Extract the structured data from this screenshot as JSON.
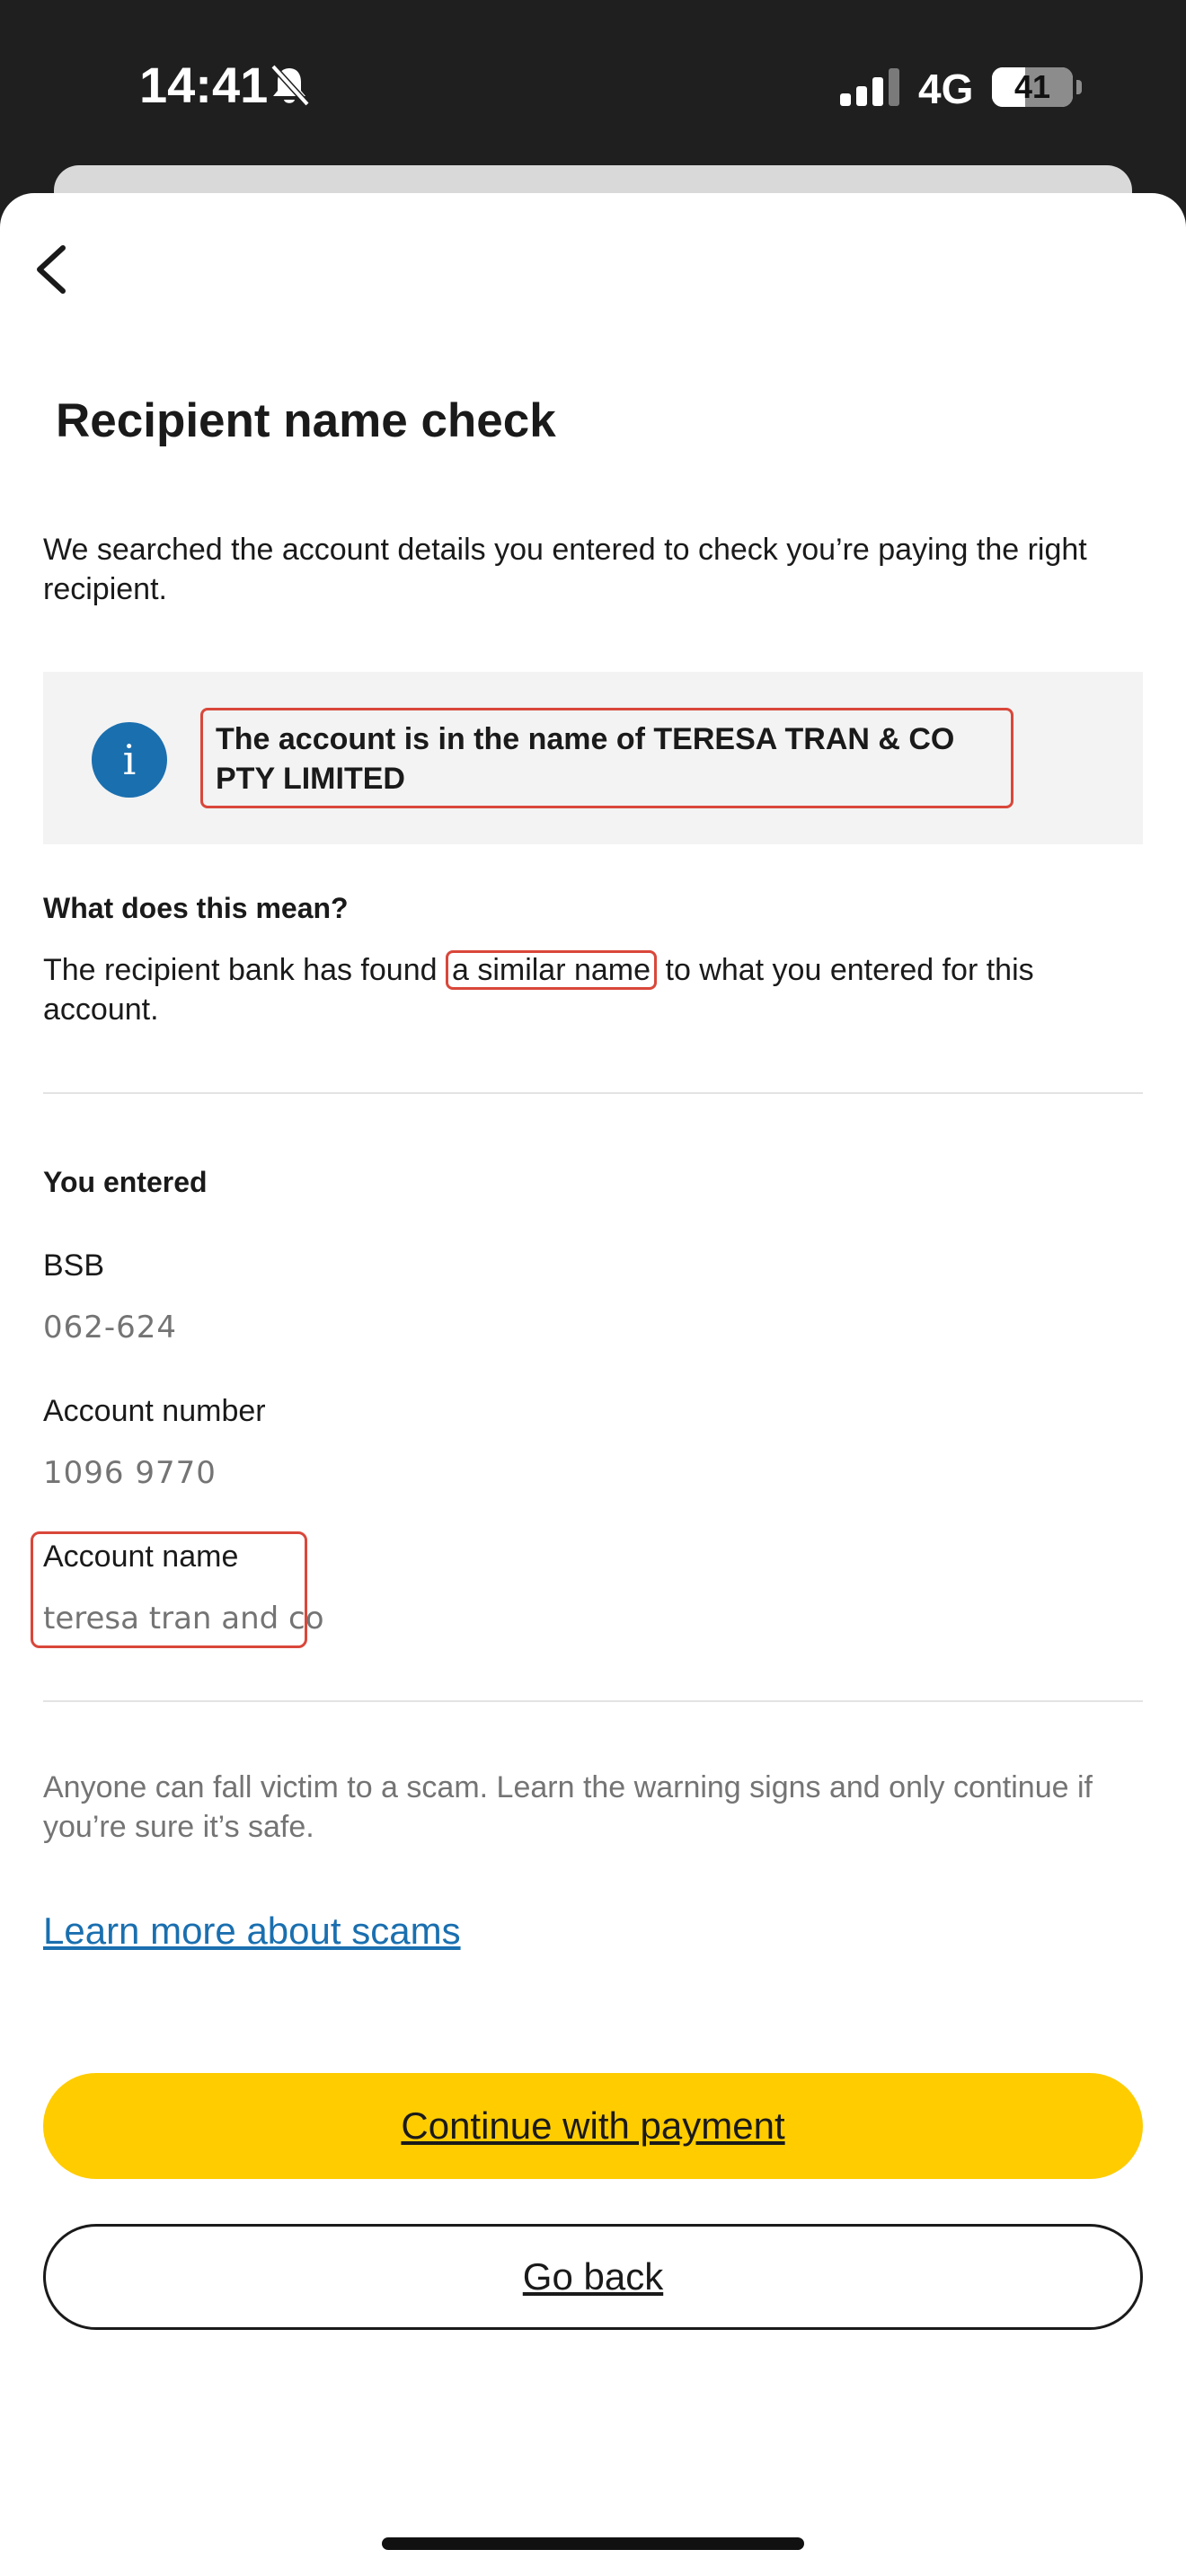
{
  "status_bar": {
    "time": "14:41",
    "network": "4G",
    "battery_level": "41",
    "battery_fraction": 0.41,
    "icons": [
      "bell-slash-icon",
      "signal-icon",
      "battery-icon"
    ]
  },
  "header": {
    "back_icon": "chevron-left-icon",
    "title": "Recipient name check"
  },
  "intro": "We searched the account details you entered to check you’re paying the right recipient.",
  "info_box": {
    "icon": "info-icon",
    "icon_glyph": "i",
    "message": "The account is in the name of TERESA TRAN & CO PTY LIMITED"
  },
  "meaning": {
    "heading": "What does this mean?",
    "text_before": "The recipient bank has found ",
    "highlight": "a similar name",
    "text_after": " to what you entered for this account."
  },
  "entered": {
    "heading": "You entered",
    "fields": [
      {
        "label": "BSB",
        "value": "062-624"
      },
      {
        "label": "Account number",
        "value": "1096 9770"
      },
      {
        "label": "Account name",
        "value": "teresa tran and co"
      }
    ]
  },
  "scam_warning": "Anyone can fall victim to a scam. Learn the warning signs and only continue if you’re sure it’s safe.",
  "scam_link": "Learn more about scams",
  "buttons": {
    "primary": "Continue with payment",
    "secondary": "Go back"
  },
  "colors": {
    "accent_yellow": "#ffcc00",
    "link_blue": "#1a6faf",
    "highlight_red": "#d9473a",
    "status_bar_bg": "#1f1f1f"
  }
}
